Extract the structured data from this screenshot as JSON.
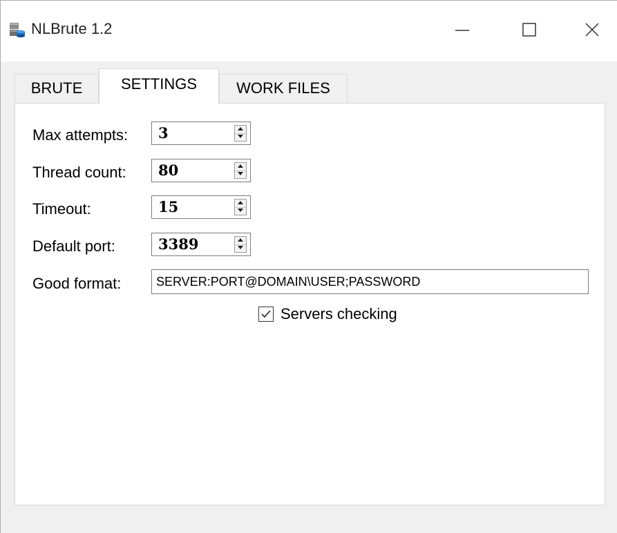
{
  "window": {
    "title": "NLBrute 1.2"
  },
  "tabs": [
    {
      "label": "BRUTE",
      "active": false
    },
    {
      "label": "SETTINGS",
      "active": true
    },
    {
      "label": "WORK FILES",
      "active": false
    }
  ],
  "settings": {
    "max_attempts": {
      "label": "Max attempts:",
      "value": "3"
    },
    "thread_count": {
      "label": "Thread count:",
      "value": "80"
    },
    "timeout": {
      "label": "Timeout:",
      "value": "15"
    },
    "default_port": {
      "label": "Default port:",
      "value": "3389"
    },
    "good_format": {
      "label": "Good format:",
      "value": "SERVER:PORT@DOMAIN\\USER;PASSWORD"
    },
    "servers_checking": {
      "label": "Servers checking",
      "checked": true
    }
  },
  "colors": {
    "titlebar": "#ffffff",
    "window_bg": "#f0f0f0",
    "panel_bg": "#ffffff",
    "border": "#d9d9d9"
  },
  "icons": {
    "app": "database-app-icon",
    "minimize": "minimize-icon",
    "maximize": "maximize-icon",
    "close": "close-icon",
    "spin_up": "arrow-up-icon",
    "spin_down": "arrow-down-icon",
    "check": "checkmark-icon"
  }
}
